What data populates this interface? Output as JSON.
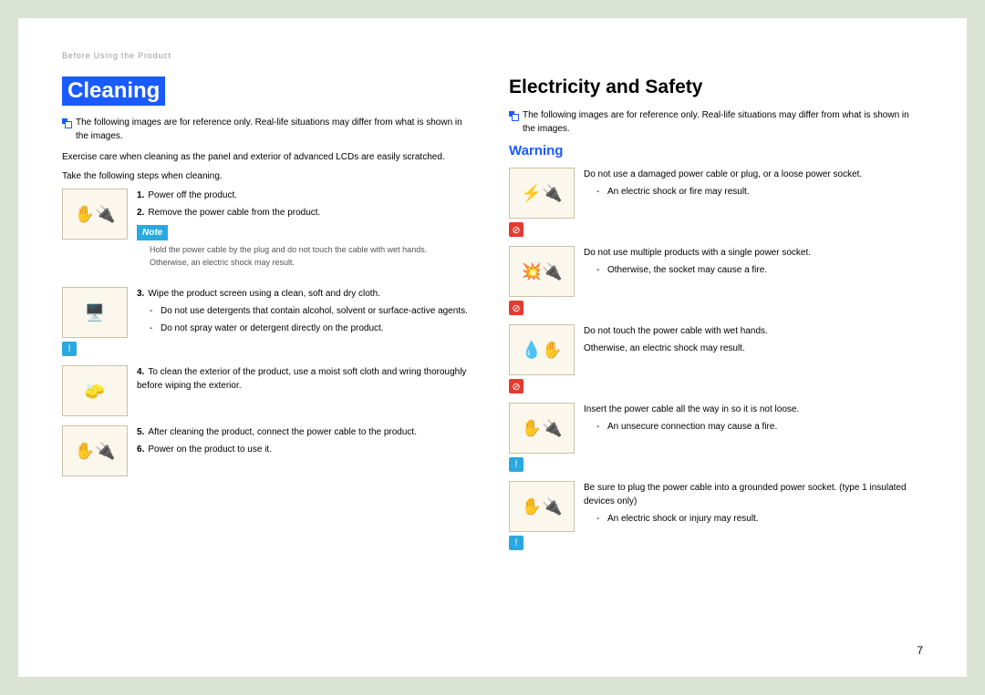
{
  "breadcrumb": "Before Using the Product",
  "page_number": "7",
  "left": {
    "title": "Cleaning",
    "ref_note": "The following images are for reference only. Real-life situations may differ from what is shown in the images.",
    "intro1": "Exercise care when cleaning as the panel and exterior of advanced LCDs are easily scratched.",
    "intro2": "Take the following steps when cleaning.",
    "block1": {
      "step1_num": "1.",
      "step1": "Power off the product.",
      "step2_num": "2.",
      "step2": "Remove the power cable from the product."
    },
    "note_label": "Note",
    "note_line1": "Hold the power cable by the plug and do not touch the cable with wet hands.",
    "note_line2": "Otherwise, an electric shock may result.",
    "block2": {
      "step3_num": "3.",
      "step3": "Wipe the product screen using a clean, soft and dry cloth.",
      "sub1": "Do not use detergents that contain alcohol, solvent or surface-active agents.",
      "sub2": "Do not spray water or detergent directly on the product."
    },
    "block3": {
      "step4_num": "4.",
      "step4": "To clean the exterior of the product, use a moist soft cloth and wring thoroughly before wiping the exterior."
    },
    "block4": {
      "step5_num": "5.",
      "step5": "After cleaning the product, connect the power cable to the product.",
      "step6_num": "6.",
      "step6": "Power on the product to use it."
    }
  },
  "right": {
    "title": "Electricity and Safety",
    "ref_note": "The following images are for reference only. Real-life situations may differ from what is shown in the images.",
    "warning_label": "Warning",
    "b1": {
      "line": "Do not use a damaged power cable or plug, or a loose power socket.",
      "sub": "An electric shock or fire may result."
    },
    "b2": {
      "line": "Do not use multiple products with a single power socket.",
      "sub": "Otherwise, the socket may cause a fire."
    },
    "b3": {
      "line1": "Do not touch the power cable with wet hands.",
      "line2": "Otherwise, an electric shock may result."
    },
    "b4": {
      "line": "Insert the power cable all the way in so it is not loose.",
      "sub": "An unsecure connection may cause a fire."
    },
    "b5": {
      "line": "Be sure to plug the power cable into a grounded power socket. (type 1 insulated devices only)",
      "sub": "An electric shock or injury may result."
    }
  },
  "icons": {
    "prohibit": "⊘",
    "info": "!"
  }
}
